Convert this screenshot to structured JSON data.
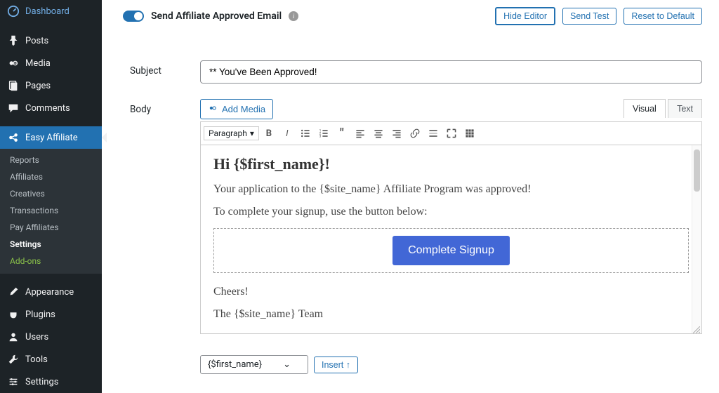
{
  "sidebar": {
    "items": [
      {
        "label": "Dashboard",
        "icon": "dashboard"
      },
      {
        "label": "Posts",
        "icon": "pin"
      },
      {
        "label": "Media",
        "icon": "media"
      },
      {
        "label": "Pages",
        "icon": "page"
      },
      {
        "label": "Comments",
        "icon": "comment"
      },
      {
        "label": "Easy Affiliate",
        "icon": "affiliate"
      },
      {
        "label": "Appearance",
        "icon": "brush"
      },
      {
        "label": "Plugins",
        "icon": "plug"
      },
      {
        "label": "Users",
        "icon": "user"
      },
      {
        "label": "Tools",
        "icon": "wrench"
      },
      {
        "label": "Settings",
        "icon": "sliders"
      }
    ],
    "sub": [
      "Reports",
      "Affiliates",
      "Creatives",
      "Transactions",
      "Pay Affiliates",
      "Settings",
      "Add-ons"
    ]
  },
  "top": {
    "toggle_label": "Send Affiliate Approved Email",
    "hide_editor": "Hide Editor",
    "send_test": "Send Test",
    "reset": "Reset to Default"
  },
  "form": {
    "subject_label": "Subject",
    "subject_value": "** You've Been Approved!",
    "body_label": "Body",
    "add_media": "Add Media",
    "visual_tab": "Visual",
    "text_tab": "Text",
    "format": "Paragraph"
  },
  "editor": {
    "heading": "Hi {$first_name}!",
    "p1": "Your application to the {$site_name} Affiliate Program was approved!",
    "p2": "To complete your signup, use the button below:",
    "cta": "Complete Signup",
    "p3": "Cheers!",
    "p4": "The {$site_name} Team"
  },
  "insert": {
    "variable": "{$first_name}",
    "button": "Insert ↑"
  }
}
